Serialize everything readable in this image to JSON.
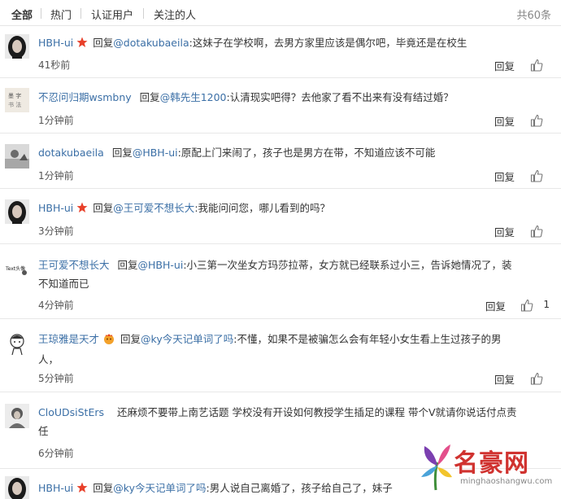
{
  "tabs": [
    {
      "label": "全部",
      "active": true
    },
    {
      "label": "热门",
      "active": false
    },
    {
      "label": "认证用户",
      "active": false
    },
    {
      "label": "关注的人",
      "active": false
    }
  ],
  "total": "共60条",
  "reply_label": "回复",
  "comments": [
    {
      "user": "HBH-ui",
      "reply_word": "回复",
      "mention": "@dotakubaeila",
      "body": ":这妹子在学校啊，去男方家里应该是偶尔吧，毕竟还是在校生",
      "time": "41秒前",
      "likes": ""
    },
    {
      "user": "不忍问归期wsmbny",
      "reply_word": "回复",
      "mention": "@韩先生1200",
      "body": ":认清现实吧得？去他家了看不出来有没有结过婚？",
      "time": "1分钟前",
      "likes": ""
    },
    {
      "user": "dotakubaeila",
      "reply_word": "回复",
      "mention": "@HBH-ui",
      "body": ":原配上门来闹了，孩子也是男方在带，不知道应该不可能",
      "time": "1分钟前",
      "likes": ""
    },
    {
      "user": "HBH-ui",
      "reply_word": "回复",
      "mention": "@王可爱不想长大",
      "body": ":我能问问您，哪儿看到的吗？",
      "time": "3分钟前",
      "likes": ""
    },
    {
      "user": "王可爱不想长大",
      "reply_word": "回复",
      "mention": "@HBH-ui",
      "body": ":小三第一次坐女方玛莎拉蒂，女方就已经联系过小三，告诉她情况了，装",
      "body2": "不知道而已",
      "time": "4分钟前",
      "likes": "1"
    },
    {
      "user": "王琼雅是天才",
      "reply_word": "回复",
      "mention": "@ky今天记单词了吗",
      "body": ":不懂，如果不是被骗怎么会有年轻小女生看上生过孩子的男",
      "body2": "人，",
      "time": "5分钟前",
      "likes": ""
    },
    {
      "user": "CloUDsiStErs",
      "reply_word": "",
      "mention": "",
      "body": "还麻烦不要带上南艺话题 学校没有开设如何教授学生插足的课程 带个V就请你说话付点责",
      "body2": "任",
      "time": "6分钟前",
      "likes": ""
    },
    {
      "user": "HBH-ui",
      "reply_word": "回复",
      "mention": "@ky今天记单词了吗",
      "body": ":男人说自己离婚了，孩子给自己了，妹子",
      "time": "",
      "likes": ""
    }
  ],
  "watermark": {
    "text": "名豪网",
    "sub": "minghaoshangwu.com"
  },
  "colors": {
    "link": "#3b6fa6",
    "text": "#333333",
    "muted": "#888888",
    "divider": "#e8e8e8",
    "badge_red": "#e8402a",
    "badge_orange": "#f3a12a",
    "watermark_red": "#d0322f"
  }
}
